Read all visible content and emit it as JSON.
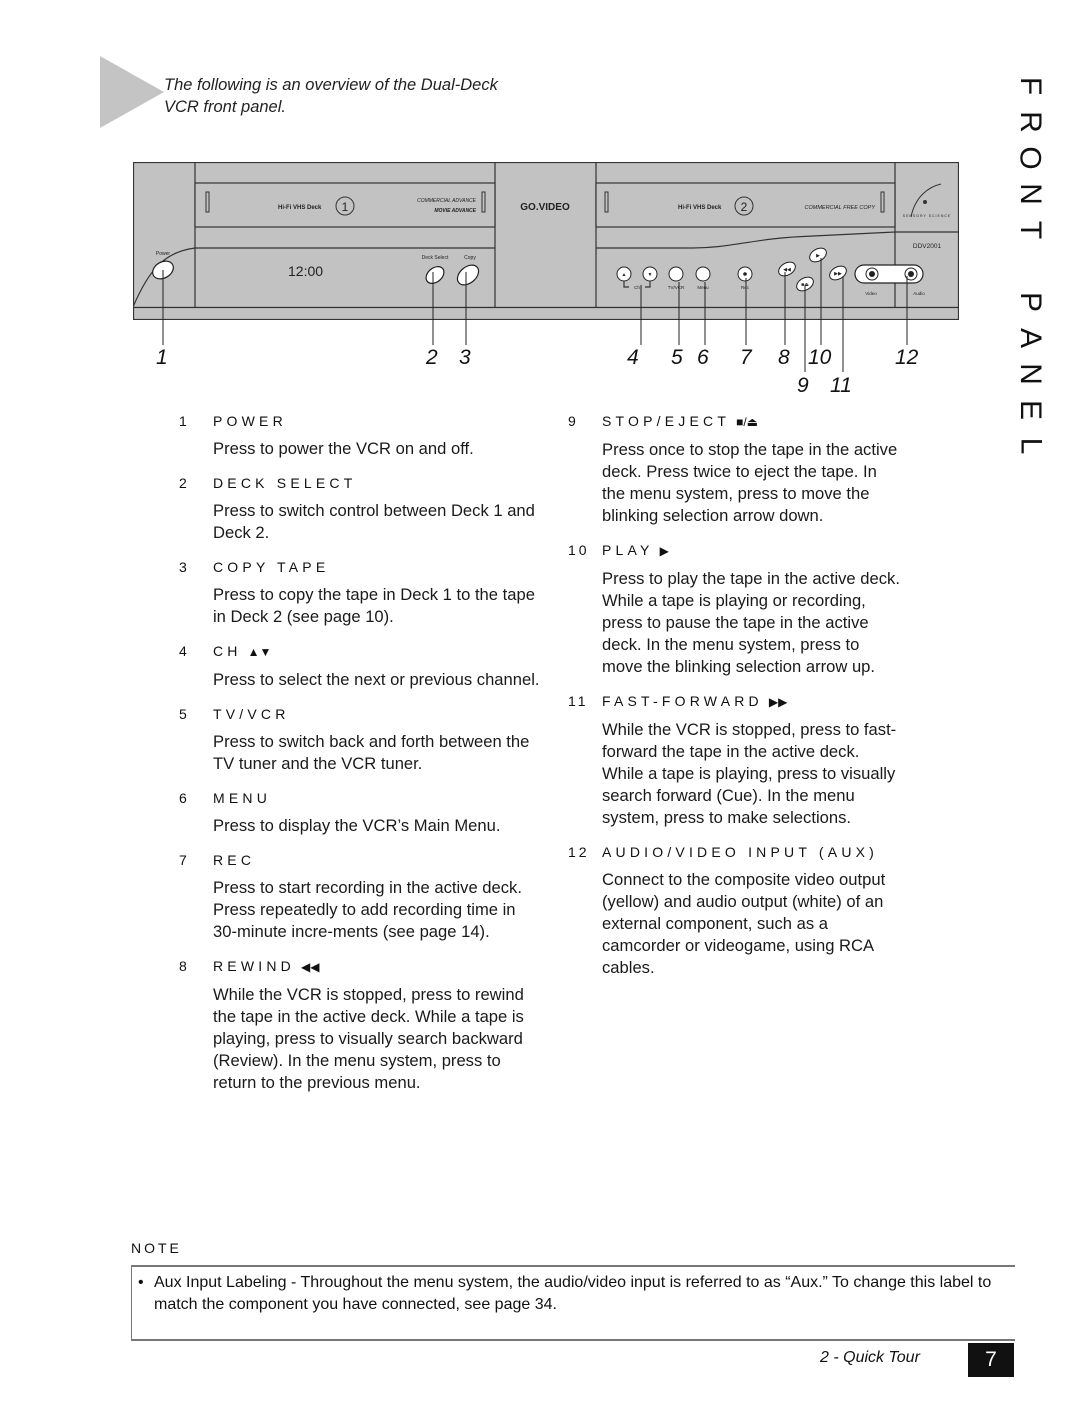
{
  "intro": {
    "text": "The following is an overview of the Dual-Deck VCR front panel."
  },
  "side_title": [
    "F",
    "R",
    "O",
    "N",
    "T",
    "",
    "P",
    "A",
    "N",
    "E",
    "L"
  ],
  "vcr": {
    "brand": "GO.VIDEO",
    "deck1": {
      "format": "Hi-Fi VHS Deck",
      "number": "1",
      "badge1": "COMMERCIAL ADVANCE",
      "badge2": "MOVIE ADVANCE"
    },
    "deck2": {
      "format": "Hi-Fi VHS Deck",
      "number": "2",
      "badge": "COMMERCIAL FREE COPY"
    },
    "display_time": "12:00",
    "model": "DDV2001",
    "maker": "SENSORY SCIENCE",
    "labels": {
      "power": "Power",
      "deck_select": "Deck Select",
      "copy": "Copy",
      "ch": "Ch",
      "tv_vcr": "TV/VCR",
      "menu": "Menu",
      "rec": "Rec",
      "video": "Video",
      "audio": "Audio"
    }
  },
  "callouts": [
    "1",
    "2",
    "3",
    "4",
    "5",
    "6",
    "7",
    "8",
    "9",
    "10",
    "11",
    "12"
  ],
  "left_items": [
    {
      "num": "1",
      "title": "POWER",
      "glyph": "",
      "body": "Press to power the VCR on and off."
    },
    {
      "num": "2",
      "title": "DECK SELECT",
      "glyph": "",
      "body": "Press to switch control between Deck 1 and Deck 2."
    },
    {
      "num": "3",
      "title": "COPY TAPE",
      "glyph": "",
      "body": "Press to copy the tape in Deck 1 to the tape in Deck 2 (see page 10)."
    },
    {
      "num": "4",
      "title": "CH",
      "glyph": "▲▼",
      "body": "Press to select the next or previous channel."
    },
    {
      "num": "5",
      "title": "TV/VCR",
      "glyph": "",
      "body": "Press to switch back and forth between the TV tuner and the VCR tuner."
    },
    {
      "num": "6",
      "title": "MENU",
      "glyph": "",
      "body": "Press to display the VCR’s Main Menu."
    },
    {
      "num": "7",
      "title": "REC",
      "glyph": "",
      "body": "Press to start recording in the active deck. Press repeatedly to add recording time in 30-minute incre-ments (see page 14)."
    },
    {
      "num": "8",
      "title": "REWIND",
      "glyph": "◀◀",
      "body": "While the VCR is stopped, press to rewind the tape in the active deck. While a tape is playing, press to visually search backward (Review). In the menu system, press to return to the previous menu."
    }
  ],
  "right_items": [
    {
      "num": "9",
      "title": "STOP/EJECT",
      "glyph": "■/⏏",
      "body": "Press once to stop the tape in the active deck. Press twice to eject the tape. In the menu system, press to move the blinking selection arrow down."
    },
    {
      "num": "10",
      "title": "PLAY",
      "glyph": "▶",
      "body": "Press to play the tape in the active deck. While a tape is playing or recording, press to pause the tape in the active deck. In the menu system, press to move the blinking selection arrow up."
    },
    {
      "num": "11",
      "title": "FAST-FORWARD",
      "glyph": "▶▶",
      "body": "While the VCR is stopped, press to fast-forward the tape in the active deck. While a tape is playing, press to visually search forward (Cue). In the menu system, press to make selections."
    },
    {
      "num": "12",
      "title": "AUDIO/VIDEO INPUT (AUX)",
      "glyph": "",
      "body": "Connect to the composite video output (yellow) and audio output (white) of an external component, such as a camcorder or videogame, using RCA cables."
    }
  ],
  "note": {
    "label": "NOTE",
    "bullet": "•",
    "text": "Aux Input Labeling - Throughout the menu system, the audio/video input is referred to as “Aux.” To change this label to match the component you have connected, see page 34."
  },
  "footer": {
    "section": "2 - Quick Tour",
    "page": "7"
  }
}
